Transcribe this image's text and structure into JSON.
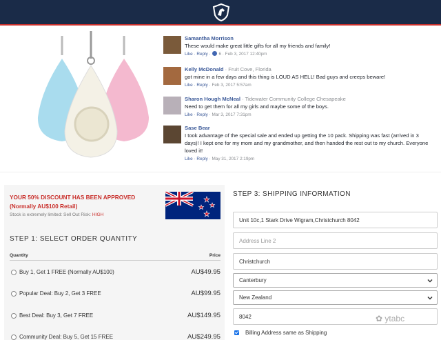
{
  "comments": [
    {
      "name": "Samantha Morrison",
      "affiliation": "",
      "text": "These would make great little gifts for all my friends and family!",
      "meta_links": "Like · Reply ·",
      "likes": "6",
      "date": "· Feb 3, 2017 12:40pm"
    },
    {
      "name": "Kelly McDonald",
      "affiliation": "· Fruit Cove, Florida",
      "text": "got mine in a few days and this thing is LOUD AS HELL! Bad guys and creeps beware!",
      "meta_links": "Like · Reply ·",
      "date": "Feb 3, 2017 5:57am"
    },
    {
      "name": "Sharon Hough McNeal",
      "affiliation": "· Tidewater Community College Chesapeake",
      "text": "Need to get them for all my girls and maybe some of the boys.",
      "meta_links": "Like · Reply ·",
      "date": "Mar 3, 2017 7:31pm"
    },
    {
      "name": "Sase Bear",
      "affiliation": "",
      "text": "I took advantage of the special sale and ended up getting the 10 pack. Shipping was fast (arrived in 3 days)! I kept one for my mom and my grandmother, and then handed the rest out to my church. Everyone loved it!",
      "meta_links": "Like · Reply ·",
      "date": "May 31, 2017 2:19pm"
    }
  ],
  "offer": {
    "discount_title": "YOUR 50% DISCOUNT HAS BEEN APPROVED (Normally AU$100 Retail)",
    "stock_text": "Stock is extremely limited: Sell Out Risk:",
    "risk_level": "HIGH"
  },
  "quantity": {
    "heading": "STEP 1: SELECT ORDER QUANTITY",
    "col_quantity": "Quantity",
    "col_price": "Price",
    "options": [
      {
        "label": "Buy 1, Get 1 FREE (Normally AU$100)",
        "price": "AU$49.95"
      },
      {
        "label": "Popular Deal: Buy 2, Get 3 FREE",
        "price": "AU$99.95"
      },
      {
        "label": "Best Deal: Buy 3, Get 7 FREE",
        "price": "AU$149.95"
      },
      {
        "label": "Community Deal: Buy 5, Get 15 FREE",
        "price": "AU$249.95"
      }
    ]
  },
  "shipping": {
    "heading": "STEP 3: SHIPPING INFORMATION",
    "address1": "Unit 10c,1 Stark Drive Wigram,Christchurch 8042",
    "address2_placeholder": "Address Line 2",
    "city": "Christchurch",
    "region": "Canterbury",
    "country": "New Zealand",
    "postcode": "8042",
    "billing_label": "Billing Address same as Shipping"
  },
  "watermark": "ytabc",
  "colors": {
    "header": "#1a2b48",
    "accent_red": "#c9302c",
    "link_blue": "#3b5998"
  }
}
